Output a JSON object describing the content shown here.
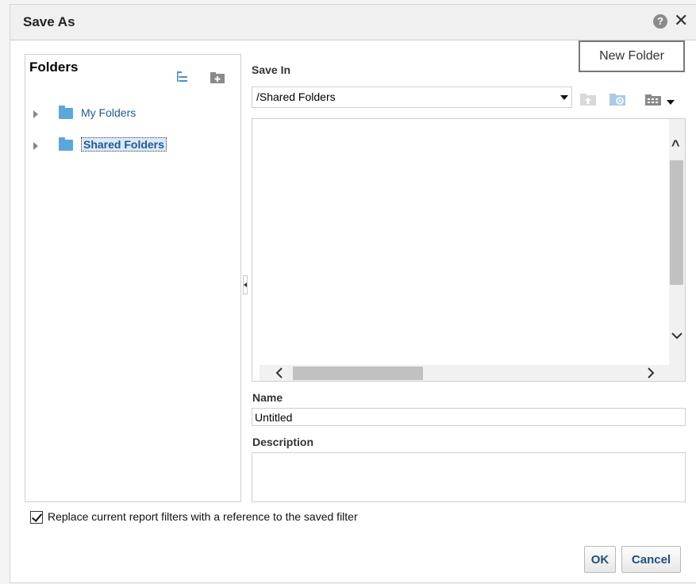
{
  "dialog": {
    "title": "Save As",
    "help_icon": "help-icon",
    "help_glyph": "?",
    "close_icon": "close-icon",
    "close_glyph": "✕"
  },
  "tooltip": {
    "text": "New Folder"
  },
  "folders_panel": {
    "title": "Folders",
    "icons": [
      "tree-view-icon",
      "new-folder-icon"
    ],
    "items": [
      {
        "label": "My Folders",
        "selected": false,
        "icon": "folder-icon"
      },
      {
        "label": "Shared Folders",
        "selected": true,
        "icon": "folder-icon"
      }
    ]
  },
  "save_in": {
    "label": "Save In",
    "path": "/Shared Folders",
    "toolbar_icons": [
      "up-folder-icon",
      "new-folder-icon",
      "view-menu-icon"
    ]
  },
  "name": {
    "label": "Name",
    "value": "Untitled"
  },
  "description": {
    "label": "Description",
    "value": ""
  },
  "replace_filters": {
    "label": "Replace current report filters with a reference to the saved filter",
    "checked": true
  },
  "buttons": {
    "ok": "OK",
    "cancel": "Cancel"
  },
  "colors": {
    "folder_blue": "#5aa7dc",
    "link_blue": "#1e5a96",
    "button_text": "#1e4f86",
    "header_bg": "#f0f0f0"
  }
}
